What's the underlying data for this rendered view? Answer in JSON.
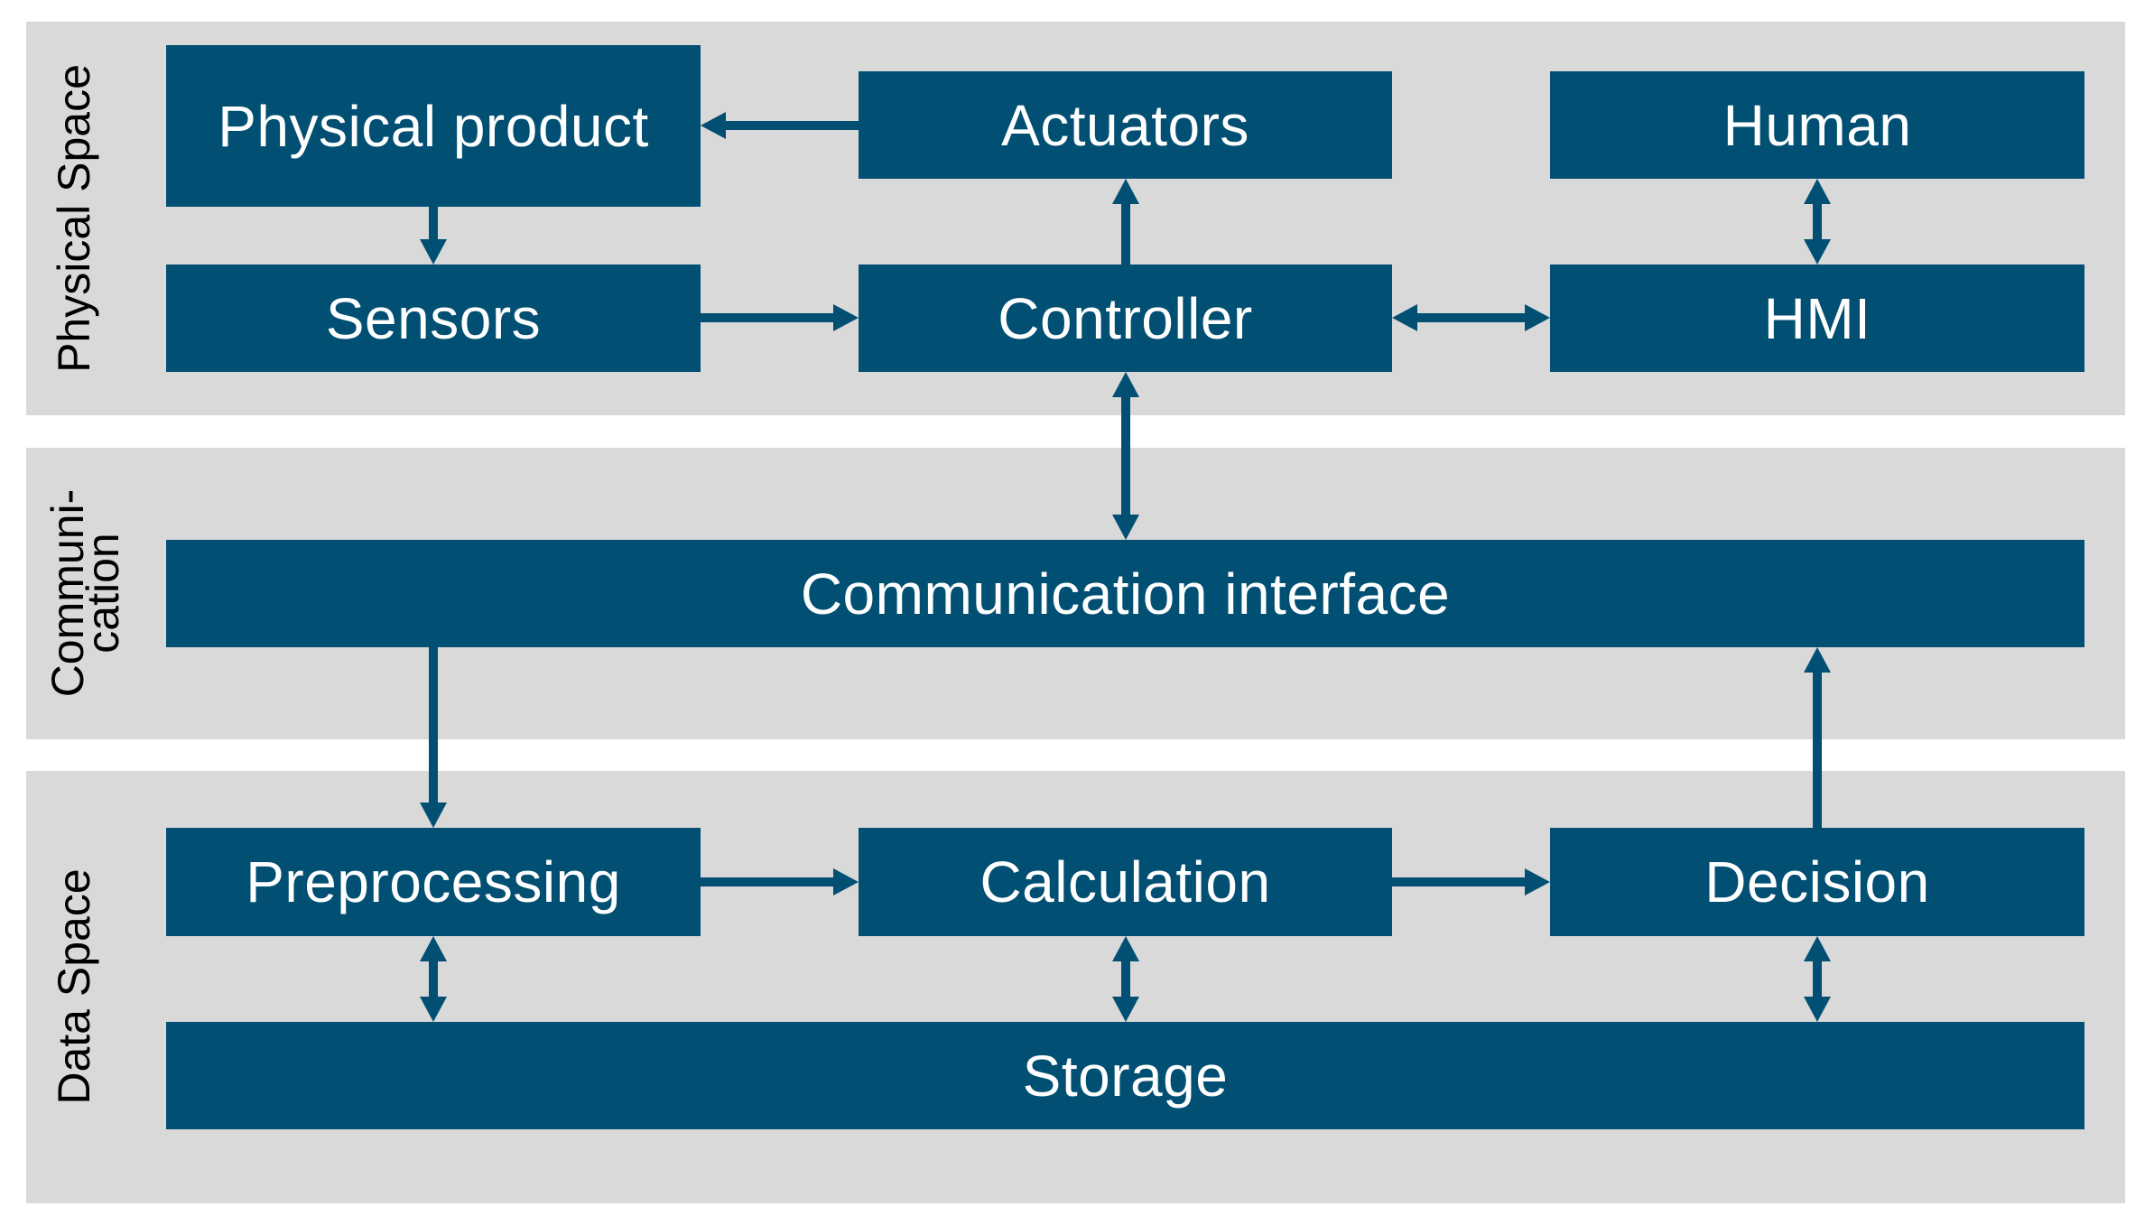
{
  "diagram": {
    "title": "",
    "colors": {
      "panel_background": "#d9d9d9",
      "box_fill": "#014f73",
      "box_text": "#ffffff",
      "arrow": "#014f73",
      "label_text": "#000000"
    },
    "layers": [
      {
        "id": "physical",
        "label": "Physical Space"
      },
      {
        "id": "communication",
        "label_lines": [
          "Communi-",
          "cation"
        ]
      },
      {
        "id": "data",
        "label": "Data Space"
      }
    ],
    "nodes": {
      "physical_product": "Physical product",
      "actuators": "Actuators",
      "human": "Human",
      "sensors": "Sensors",
      "controller": "Controller",
      "hmi": "HMI",
      "communication_interface": "Communication interface",
      "preprocessing": "Preprocessing",
      "calculation": "Calculation",
      "decision": "Decision",
      "storage": "Storage"
    },
    "edges": [
      {
        "from": "actuators",
        "to": "physical_product",
        "direction": "one-way"
      },
      {
        "from": "physical_product",
        "to": "sensors",
        "direction": "one-way"
      },
      {
        "from": "controller",
        "to": "actuators",
        "direction": "one-way"
      },
      {
        "from": "sensors",
        "to": "controller",
        "direction": "one-way"
      },
      {
        "from": "controller",
        "to": "hmi",
        "direction": "two-way"
      },
      {
        "from": "human",
        "to": "hmi",
        "direction": "two-way"
      },
      {
        "from": "controller",
        "to": "communication_interface",
        "direction": "two-way"
      },
      {
        "from": "communication_interface",
        "to": "preprocessing",
        "direction": "one-way"
      },
      {
        "from": "decision",
        "to": "communication_interface",
        "direction": "one-way"
      },
      {
        "from": "preprocessing",
        "to": "calculation",
        "direction": "one-way"
      },
      {
        "from": "calculation",
        "to": "decision",
        "direction": "one-way"
      },
      {
        "from": "preprocessing",
        "to": "storage",
        "direction": "two-way"
      },
      {
        "from": "calculation",
        "to": "storage",
        "direction": "two-way"
      },
      {
        "from": "decision",
        "to": "storage",
        "direction": "two-way"
      }
    ]
  }
}
